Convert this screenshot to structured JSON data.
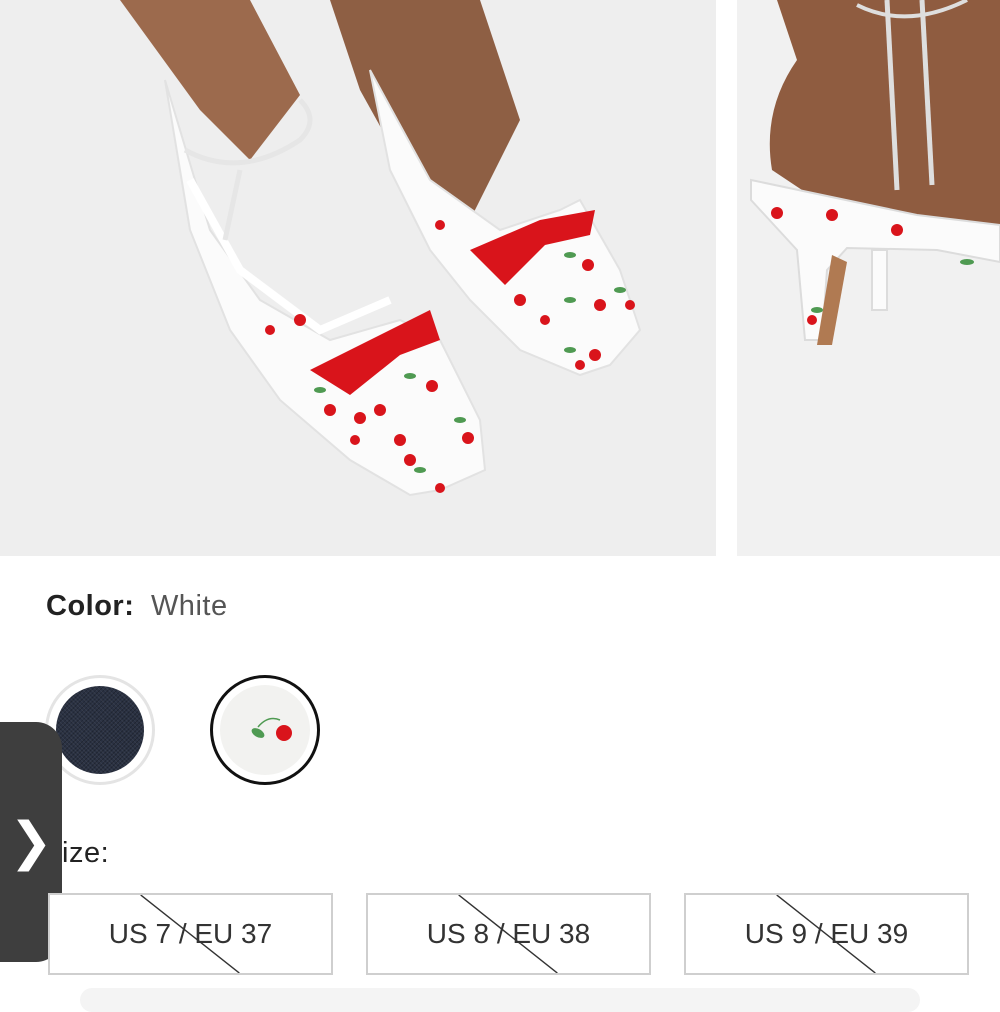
{
  "product": {
    "color_label": "Color:",
    "color_value": "White",
    "size_label": "Size:",
    "size_label_visible": "ize:",
    "swatches": [
      {
        "name": "denim",
        "selected": false
      },
      {
        "name": "white-cherry",
        "selected": true
      }
    ],
    "sizes": [
      {
        "label": "US 7 / EU 37",
        "available": false
      },
      {
        "label": "US 8 / EU 38",
        "available": false
      },
      {
        "label": "US 9 / EU 39",
        "available": false
      }
    ]
  },
  "side_tab": {
    "icon": "chevron-right-icon",
    "glyph": "❯"
  },
  "colors": {
    "accent_red": "#d9141b",
    "leaf_green": "#4f9a52",
    "tab_bg": "#3e3e3e",
    "border": "#cfcfcf"
  }
}
